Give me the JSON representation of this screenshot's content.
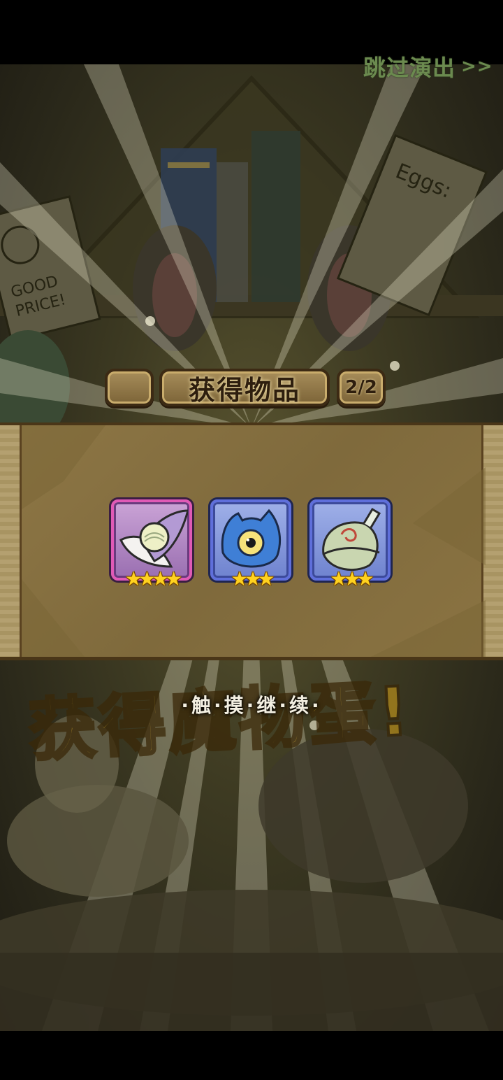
{
  "top_bar": {
    "skip_label": "跳过演出",
    "skip_arrows": ">>"
  },
  "reward_header": {
    "title": "获得物品",
    "page_indicator": "2/2"
  },
  "items": [
    {
      "name": "feather-leaf-item-icon",
      "frame": "purple",
      "stars": "★★★★",
      "star_count": 4
    },
    {
      "name": "blue-eye-slime-item-icon",
      "frame": "blue",
      "stars": "★★★",
      "star_count": 3
    },
    {
      "name": "green-shell-egg-item-icon",
      "frame": "blue",
      "stars": "★★★",
      "star_count": 3
    }
  ],
  "background": {
    "banner_text": "获得魔物蛋!",
    "sign_text": "GOOD PRICE!",
    "poster_text": "Eggs:"
  },
  "hint": {
    "touch_continue": "·触·摸·继·续·"
  },
  "colors": {
    "skip_text": "#6b8a4f",
    "panel": "#8a7244",
    "purple_frame": "#e05ab6",
    "blue_frame": "#5f6fdb",
    "star": "#ffd21f"
  }
}
